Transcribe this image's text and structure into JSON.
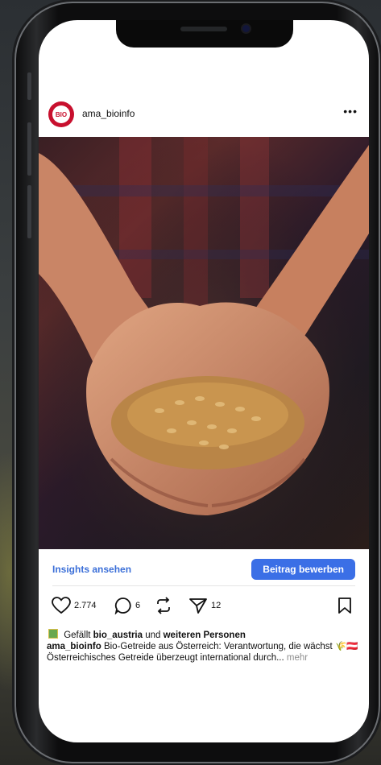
{
  "post": {
    "username": "ama_bioinfo",
    "avatar_label": "BIO",
    "more_icon": "•••"
  },
  "insights": {
    "view_label": "Insights ansehen",
    "promote_label": "Beitrag bewerben"
  },
  "actions": {
    "likes": "2.774",
    "comments": "6",
    "sends": "12"
  },
  "caption": {
    "liked_prefix": "Gefällt",
    "liked_user": "bio_austria",
    "liked_mid": "und",
    "liked_others": "weiteren Personen",
    "author": "ama_bioinfo",
    "text": "Bio-Getreide aus Österreich: Verantwortung, die wächst 🌾🇦🇹",
    "line2": "Österreichisches Getreide überzeugt international durch...",
    "more": "mehr"
  },
  "colors": {
    "accent": "#3b6fe6",
    "brand_red": "#c8102e"
  }
}
